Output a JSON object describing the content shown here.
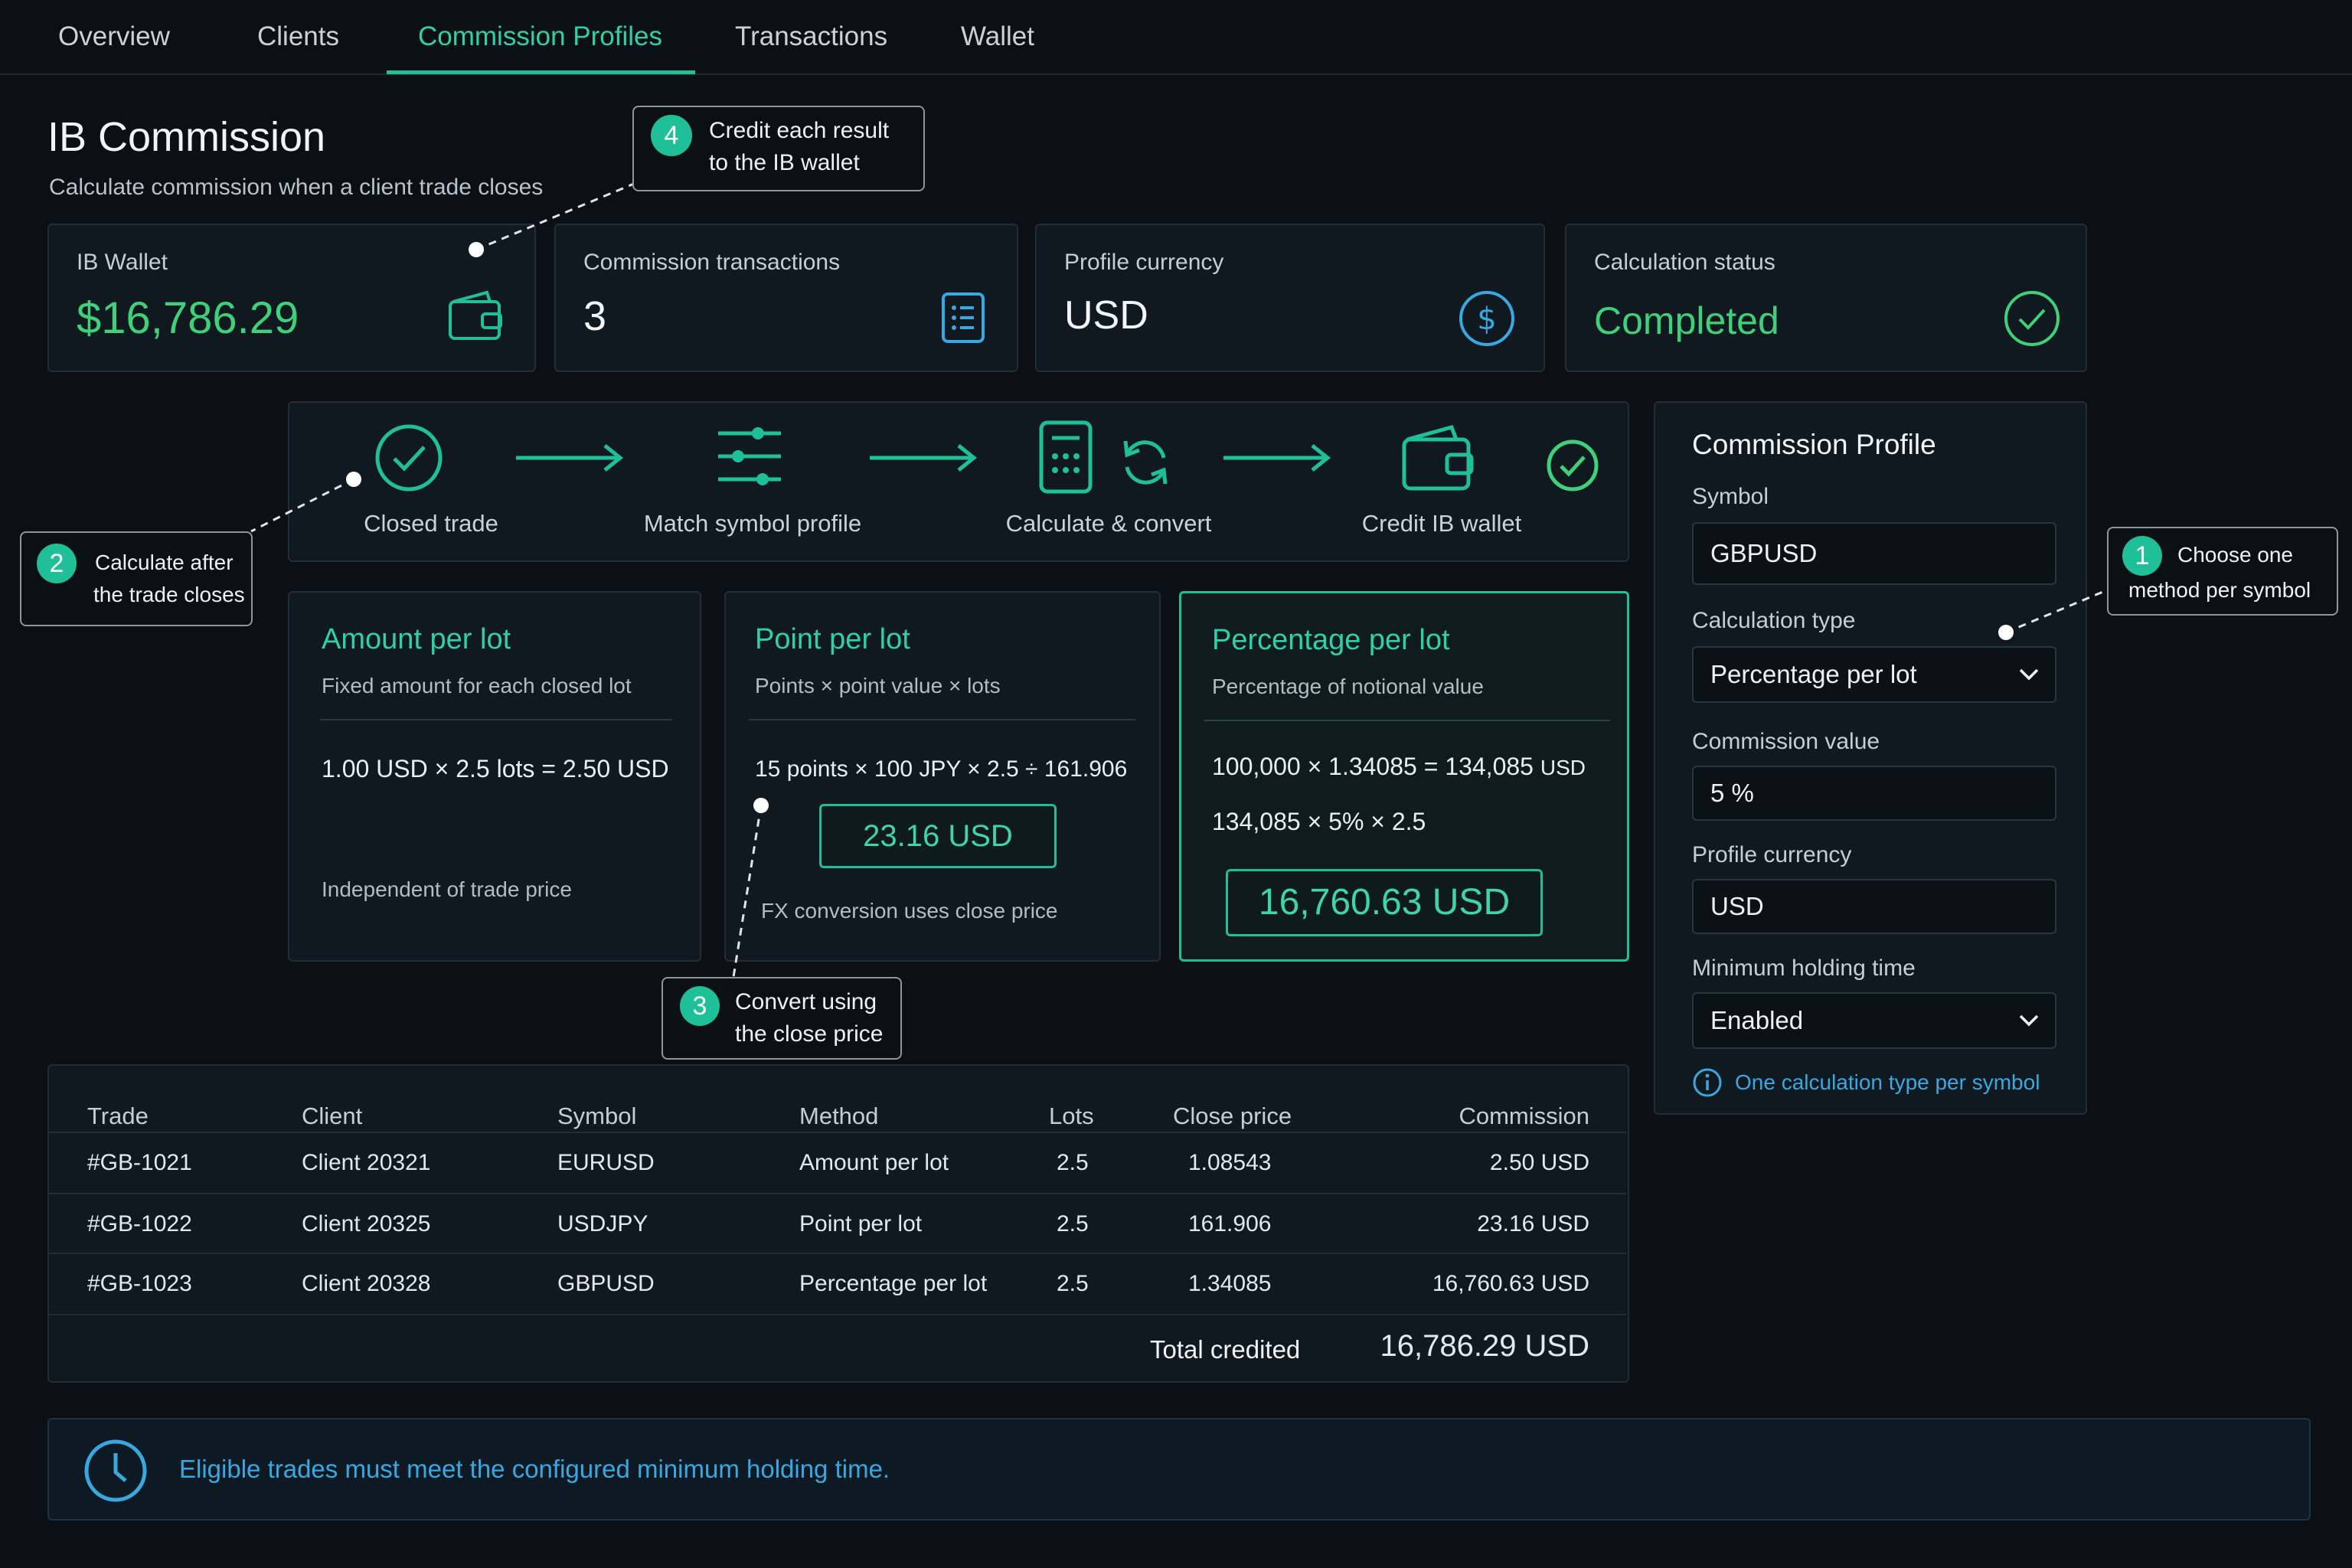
{
  "nav": {
    "tabs": [
      {
        "label": "Overview"
      },
      {
        "label": "Clients"
      },
      {
        "label": "Commission Profiles",
        "active": true
      },
      {
        "label": "Transactions"
      },
      {
        "label": "Wallet"
      }
    ]
  },
  "header": {
    "title": "IB Commission",
    "subtitle": "Calculate commission when a client trade closes"
  },
  "stats": {
    "wallet": {
      "label": "IB Wallet",
      "value": "$16,786.29",
      "icon": "wallet-icon"
    },
    "transactions": {
      "label": "Commission transactions",
      "value": "3",
      "icon": "list-icon"
    },
    "currency": {
      "label": "Profile currency",
      "value": "USD",
      "icon": "dollar-icon"
    },
    "status": {
      "label": "Calculation status",
      "value": "Completed",
      "icon": "check-circle-icon"
    }
  },
  "flow": {
    "steps": [
      {
        "label": "Closed trade",
        "icon": "check-circle-icon"
      },
      {
        "label": "Match symbol profile",
        "icon": "sliders-icon"
      },
      {
        "label": "Calculate & convert",
        "icon": "calculator-icon"
      },
      {
        "label": "Credit IB wallet",
        "icon": "wallet-icon"
      }
    ]
  },
  "methods": {
    "amount": {
      "title": "Amount per lot",
      "subtitle": "Fixed amount for each closed lot",
      "formula": "1.00 USD × 2.5 lots = 2.50 USD",
      "note": "Independent of trade price"
    },
    "point": {
      "title": "Point per lot",
      "subtitle": "Points × point value × lots",
      "formula": "15 points × 100 JPY × 2.5 ÷ 161.906",
      "result": "23.16 USD",
      "note": "FX conversion uses close price"
    },
    "percentage": {
      "title": "Percentage per lot",
      "subtitle": "Percentage of notional value",
      "formula1": "100,000 × 1.34085 = 134,085",
      "formula1_unit": "USD",
      "formula2": "134,085 × 5% × 2.5",
      "result": "16,760.63 USD"
    }
  },
  "profile": {
    "heading": "Commission Profile",
    "symbol_label": "Symbol",
    "symbol_value": "GBPUSD",
    "calc_type_label": "Calculation type",
    "calc_type_value": "Percentage per lot",
    "commission_label": "Commission value",
    "commission_value": "5 %",
    "currency_label": "Profile currency",
    "currency_value": "USD",
    "holding_label": "Minimum holding time",
    "holding_value": "Enabled",
    "hint": "One calculation type per symbol"
  },
  "callouts": {
    "c1": {
      "number": "1",
      "line1": "Choose one",
      "line2": "method per symbol"
    },
    "c2": {
      "number": "2",
      "line1": "Calculate after",
      "line2": "the trade closes"
    },
    "c3": {
      "number": "3",
      "line1": "Convert using",
      "line2": "the close price"
    },
    "c4": {
      "number": "4",
      "line1": "Credit each result",
      "line2": "to the IB wallet"
    }
  },
  "table": {
    "headers": [
      "Trade",
      "Client",
      "Symbol",
      "Method",
      "Lots",
      "Close price",
      "Commission"
    ],
    "rows": [
      [
        "#GB-1021",
        "Client 20321",
        "EURUSD",
        "Amount per lot",
        "2.5",
        "1.08543",
        "2.50 USD"
      ],
      [
        "#GB-1022",
        "Client 20325",
        "USDJPY",
        "Point per lot",
        "2.5",
        "161.906",
        "23.16 USD"
      ],
      [
        "#GB-1023",
        "Client 20328",
        "GBPUSD",
        "Percentage per lot",
        "2.5",
        "1.34085",
        "16,760.63 USD"
      ]
    ],
    "total_label": "Total credited",
    "total_value": "16,786.29 USD"
  },
  "banner": {
    "text": "Eligible trades must meet the configured minimum holding time.",
    "icon": "clock-icon"
  },
  "colors": {
    "accent": "#1fbf97",
    "positive": "#3fd07a",
    "link": "#3aa8e0"
  }
}
